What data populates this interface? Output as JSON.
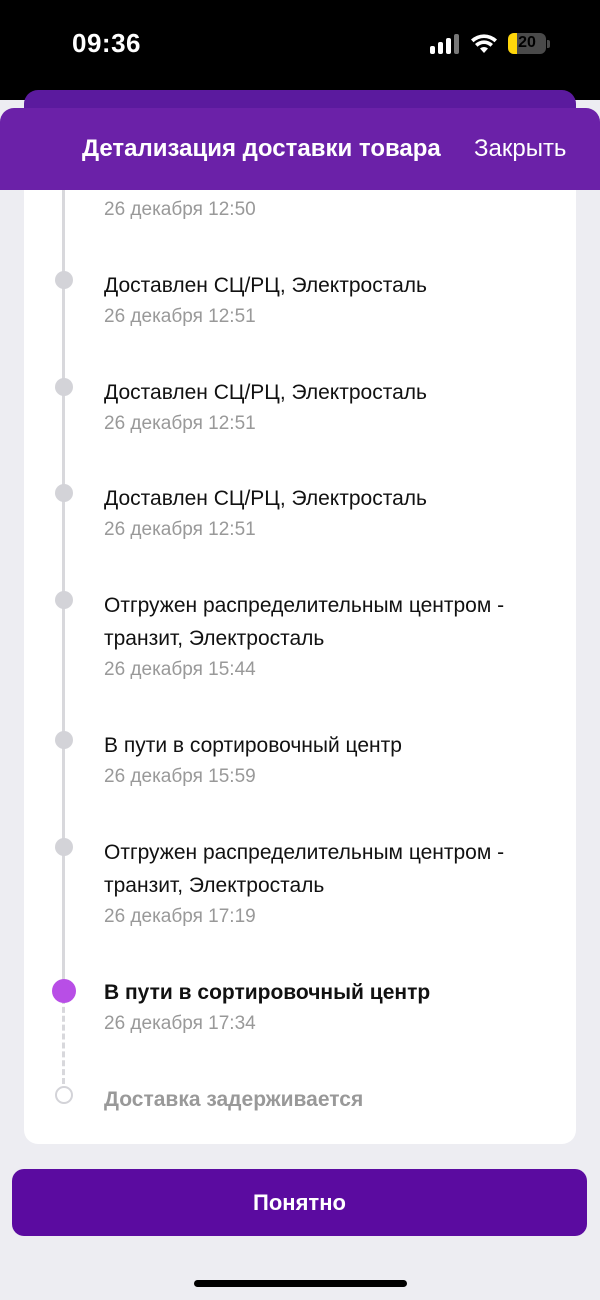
{
  "status_bar": {
    "time": "09:36",
    "battery": "20",
    "icons": [
      "cellular-signal-icon",
      "wifi-icon",
      "battery-icon"
    ]
  },
  "header": {
    "title": "Детализация доставки товара",
    "close_label": "Закрыть"
  },
  "timeline": {
    "colors": {
      "active": "#b84ee6",
      "inactive": "#d3d3d8",
      "accent": "#6b21a8"
    },
    "partial_top_time": "26 декабря 12:50",
    "events": [
      {
        "title": "Доставлен СЦ/РЦ, Электросталь",
        "time": "26 декабря 12:51"
      },
      {
        "title": "Доставлен СЦ/РЦ, Электросталь",
        "time": "26 декабря 12:51"
      },
      {
        "title": "Доставлен СЦ/РЦ, Электросталь",
        "time": "26 декабря 12:51"
      },
      {
        "title": "Отгружен распределительным центром - транзит, Электросталь",
        "time": "26 декабря 15:44"
      },
      {
        "title": "В пути в сортировочный центр",
        "time": "26 декабря 15:59"
      },
      {
        "title": "Отгружен распределительным центром - транзит, Электросталь",
        "time": "26 декабря 17:19"
      },
      {
        "title": "В пути в сортировочный центр",
        "time": "26 декабря 17:34",
        "state": "current"
      }
    ],
    "pending": {
      "title": "Доставка задерживается"
    }
  },
  "footer": {
    "ok_button_label": "Понятно"
  }
}
